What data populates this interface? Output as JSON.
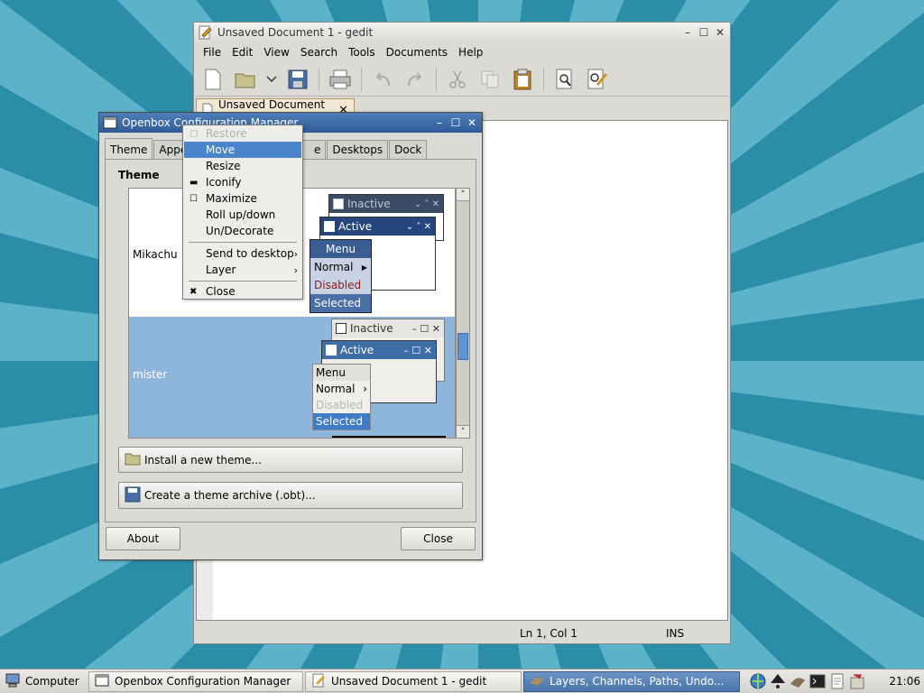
{
  "gedit": {
    "title": "Unsaved Document 1 - gedit",
    "menu": [
      "File",
      "Edit",
      "View",
      "Search",
      "Tools",
      "Documents",
      "Help"
    ],
    "tab_label": "Unsaved Document 1",
    "status": {
      "position": "Ln 1, Col 1",
      "mode": "INS"
    }
  },
  "ob": {
    "title": "Openbox Configuration Manager",
    "tabs": {
      "theme": "Theme",
      "appearance": "Appea",
      "e": "e",
      "desktops": "Desktops",
      "dock": "Dock"
    },
    "section_title": "Theme",
    "themes": [
      "Mikachu",
      "mister"
    ],
    "preview": {
      "inactive": "Inactive",
      "active": "Active",
      "menu": "Menu",
      "normal": "Normal",
      "disabled": "Disabled",
      "selected": "Selected"
    },
    "install_label": "Install a new theme...",
    "archive_label": "Create a theme archive (.obt)...",
    "about_label": "About",
    "close_label": "Close"
  },
  "popup": {
    "items": [
      "Restore",
      "Move",
      "Resize",
      "Iconify",
      "Maximize",
      "Roll up/down",
      "Un/Decorate",
      "Send to desktop",
      "Layer",
      "Close"
    ]
  },
  "taskbar": {
    "start": "Computer",
    "tasks": [
      "Openbox Configuration Manager",
      "Unsaved Document 1 - gedit",
      "Layers, Channels, Paths, Undo..."
    ],
    "clock": "21:06"
  },
  "colors": {
    "accent": "#4a85c9",
    "titlebar": "#2f5d98",
    "desktop": "#2a93ad"
  }
}
